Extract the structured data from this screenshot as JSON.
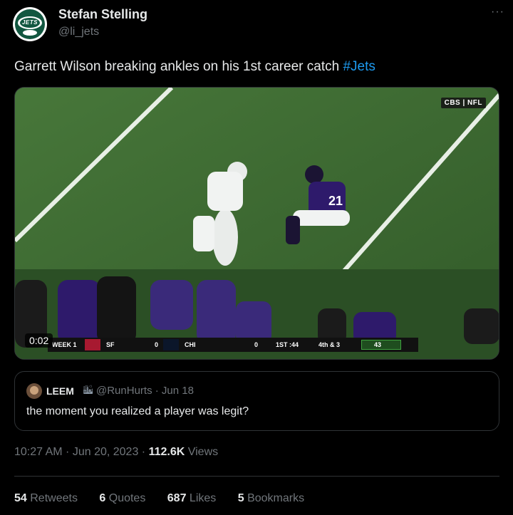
{
  "author": {
    "name": "Stefan Stelling",
    "handle": "@li_jets",
    "avatar_text": "JETS"
  },
  "more_icon": "more-icon",
  "tweet": {
    "text": "Garrett Wilson breaking ankles on his 1st career catch ",
    "hashtag": "#Jets"
  },
  "video": {
    "timecode": "0:02",
    "network": "CBS | NFL",
    "scorebug": {
      "week": "WEEK 1",
      "team1": "SF",
      "score1": "0",
      "team2": "CHI",
      "score2": "0",
      "clock": "1ST :44",
      "down": "4th & 3",
      "play_clock": "43"
    }
  },
  "quoted_tweet": {
    "name": "LEEM",
    "badge": "🏙",
    "handle": "@RunHurts · Jun 18",
    "text": "the moment you realized a player was legit?"
  },
  "meta": {
    "time_date": "10:27 AM · Jun 20, 2023 · ",
    "views_count": "112.6K",
    "views_label": " Views"
  },
  "stats": {
    "retweets_count": "54",
    "retweets_label": " Retweets",
    "quotes_count": "6",
    "quotes_label": " Quotes",
    "likes_count": "687",
    "likes_label": " Likes",
    "bookmarks_count": "5",
    "bookmarks_label": " Bookmarks"
  },
  "colors": {
    "background": "#000000",
    "text": "#e7e9ea",
    "muted": "#71767b",
    "link": "#1d9bf0",
    "border": "#2f3336"
  }
}
